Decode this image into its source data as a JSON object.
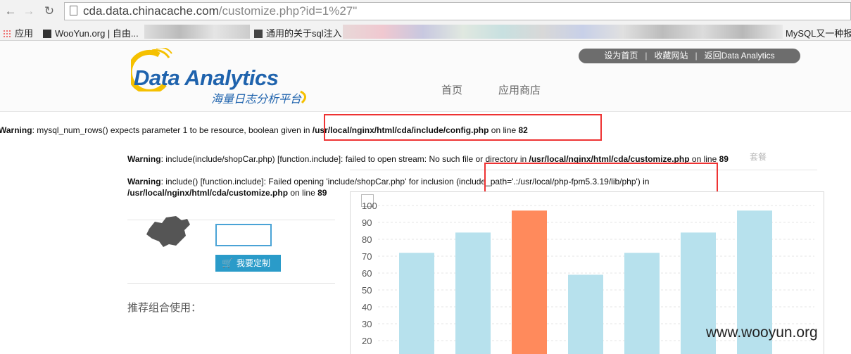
{
  "browser": {
    "url_host": "cda.data.chinacache.com",
    "url_path": "/customize.php?id=1%27\"",
    "bookmarks": [
      {
        "label": "应用"
      },
      {
        "label": "WooYun.org | 自由..."
      },
      {
        "label": "通用的关于sql注入"
      },
      {
        "label": "MySQL又一种报错"
      }
    ]
  },
  "header": {
    "logo_title": "Data Analytics",
    "logo_sub": "海量日志分析平台",
    "toplinks": [
      "设为首页",
      "收藏网站",
      "返回Data Analytics"
    ],
    "nav": [
      "首页",
      "应用商店"
    ]
  },
  "warnings": {
    "w1": {
      "label": "Warning",
      "text": ": mysql_num_rows() expects parameter 1 to be resource, boolean given in ",
      "path": "/usr/local/nginx/html/cda/include/config.php",
      "line_text": " on line ",
      "line": "82"
    },
    "w2": {
      "label": "Warning",
      "text": ": include(include/shopCar.php) [function.include]: failed to open stream: No such file or directory in ",
      "path": "/usr/local/nginx/html/cda/customize.php",
      "line_text": " on line ",
      "line": "89"
    },
    "w3": {
      "label": "Warning",
      "text": ": include() [function.include]: Failed opening 'include/shopCar.php' for inclusion (include_path='.:/usr/local/php-fpm5.3.19/lib/php') in",
      "path": "/usr/local/nginx/html/cda/customize.php",
      "line_text": " on line ",
      "line": "89"
    },
    "hidden_text": "套餐"
  },
  "left_panel": {
    "custom_button": "我要定制",
    "recommend_label": "推荐组合使用："
  },
  "watermark": "www.wooyun.org",
  "colors": {
    "bar": "#b7e1ed",
    "bar_highlight": "#ff8a5c",
    "redbox": "#e33333",
    "button": "#2a9bc9"
  },
  "chart_data": {
    "type": "bar",
    "y_ticks": [
      "100",
      "90",
      "80",
      "70",
      "60",
      "50",
      "40",
      "30",
      "20"
    ],
    "ylim": [
      15,
      100
    ],
    "values": [
      72,
      84,
      97,
      59,
      72,
      84,
      97
    ],
    "highlight_index": 2,
    "grid": true
  }
}
